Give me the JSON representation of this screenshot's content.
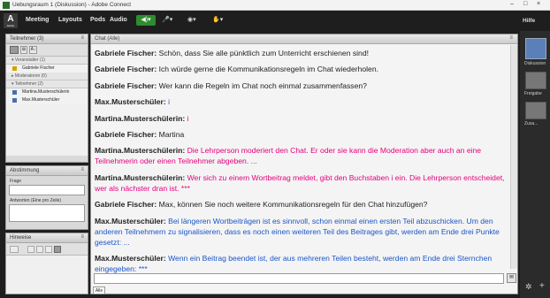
{
  "window": {
    "title": "Uebungsraum 1 (Diskussion) - Adobe Connect",
    "controls": [
      "–",
      "□",
      "×"
    ]
  },
  "menubar": {
    "logo_text": "A",
    "logo_sub": "Adobe",
    "items": [
      "Meeting",
      "Layouts",
      "Pods",
      "Audio"
    ],
    "help": "Hilfe",
    "colors": {
      "speaker_green": "#2e8b2e",
      "bar": "#1e1e1e"
    }
  },
  "participants_pod": {
    "title": "Teilnehmer (3)",
    "menu_icon": "≡",
    "groups": [
      {
        "label": "Veranstalter (1)",
        "users": [
          "Gabriele Fischer"
        ]
      },
      {
        "label": "Moderatoren (0)",
        "users": []
      },
      {
        "label": "Teilnehmer (2)",
        "users": [
          "Martina.Musterschülerin",
          "Max.Musterschüler"
        ]
      }
    ]
  },
  "poll_pod": {
    "title": "Abstimmung",
    "menu_icon": "≡",
    "question_label": "Frage",
    "answers_label": "Antworten (Eine pro Zeile)"
  },
  "notes_pod": {
    "title": "Hinweise",
    "menu_icon": "≡"
  },
  "chat_pod": {
    "title": "Chat (Alle)",
    "menu_icon": "≡",
    "tab_label": "Alle",
    "colors": {
      "teacher": "#222222",
      "martina": "#e6007e",
      "max": "#1a56c8"
    },
    "messages": [
      {
        "sender": "Gabriele Fischer:",
        "text": " Schön, dass Sie alle pünktlich zum Unterricht erschienen sind!",
        "role": "teacher"
      },
      {
        "sender": "Gabriele Fischer:",
        "text": " Ich würde gerne die Kommunikationsregeln im Chat wiederholen.",
        "role": "teacher"
      },
      {
        "sender": "Gabriele Fischer:",
        "text": " Wer kann die Regeln im Chat noch einmal zusammenfassen?",
        "role": "teacher"
      },
      {
        "sender": "Max.Musterschüler:",
        "text": " i",
        "role": "max"
      },
      {
        "sender": "Martina.Musterschülerin:",
        "text": " i",
        "role": "martina"
      },
      {
        "sender": "Gabriele Fischer:",
        "text": " Martina",
        "role": "teacher"
      },
      {
        "sender": "Martina.Musterschülerin:",
        "text": " Die Lehrperson moderiert den Chat. Er oder sie kann die Moderation aber auch an eine Teilnehmerin oder einen Teilnehmer abgeben. ...",
        "role": "martina"
      },
      {
        "sender": "Martina.Musterschülerin:",
        "text": " Wer sich zu einem Wortbeitrag meldet, gibt den Buchstaben i ein. Die Lehrperson entscheidet, wer als nächster dran ist. ***",
        "role": "martina"
      },
      {
        "sender": "Gabriele Fischer:",
        "text": " Max, können Sie noch weitere Kommunikationsregeln für den Chat hinzufügen?",
        "role": "teacher"
      },
      {
        "sender": "Max.Musterschüler:",
        "text": " Bei längeren Wortbeiträgen ist es sinnvoll, schon einmal einen ersten Teil abzuschicken. Um den anderen Teilnehmern zu signalisieren, dass es noch einen weiteren Teil des Beitrages gibt, werden am Ende drei Punkte gesetzt: ...",
        "role": "max"
      },
      {
        "sender": "Max.Musterschüler:",
        "text": " Wenn ein Beitrag beendet ist, der aus mehreren Teilen besteht, werden am Ende drei Sternchen eingegeben: ***",
        "role": "max"
      }
    ]
  },
  "right_strip": {
    "labels": [
      "Diskussion",
      "Freigabe",
      "Zusa..."
    ]
  }
}
